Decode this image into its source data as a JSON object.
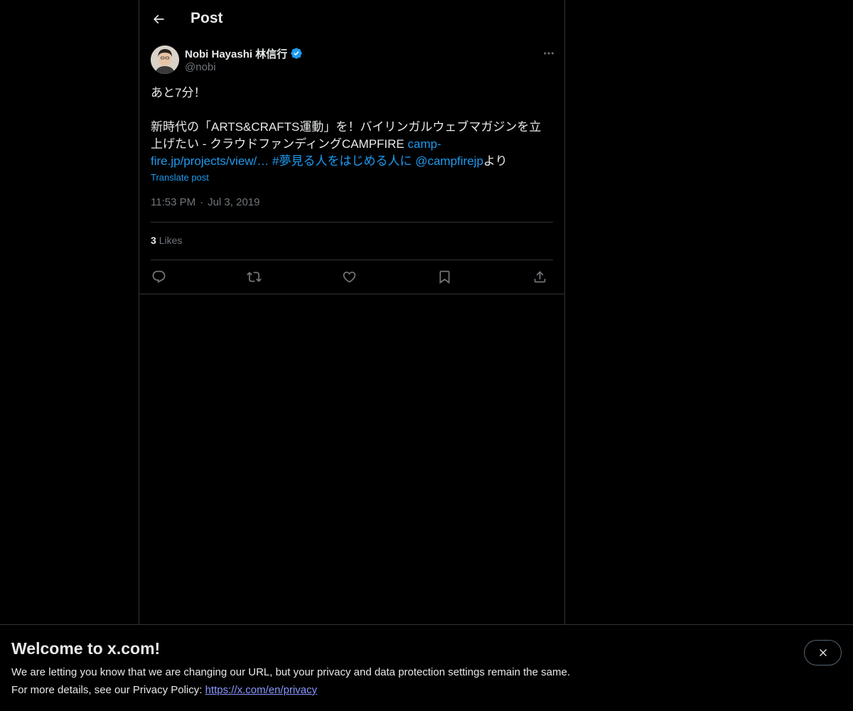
{
  "header": {
    "title": "Post",
    "back_icon": "arrow-left-icon"
  },
  "post": {
    "author": {
      "display_name": "Nobi Hayashi 林信行",
      "handle": "@nobi",
      "verified": true,
      "verified_color": "#1d9bf0"
    },
    "text_line1": "あと7分！",
    "text_body": "新時代の「ARTS&CRAFTS運動」を！バイリンガルウェブマガジンを立上げたい - クラウドファンディングCAMPFIRE ",
    "link_url": "camp-fire.jp/projects/view/…",
    "hashtag": "#夢見る人をはじめる人に",
    "mention": "@campfirejp",
    "text_suffix": "より",
    "translate_label": "Translate post",
    "time": "11:53 PM",
    "separator": "·",
    "date": "Jul 3, 2019",
    "likes_count": "3",
    "likes_label": "Likes",
    "actions": [
      "reply-icon",
      "repost-icon",
      "like-icon",
      "bookmark-icon",
      "share-icon"
    ]
  },
  "banner": {
    "title": "Welcome to x.com!",
    "line1": "We are letting you know that we are changing our URL, but your privacy and data protection settings remain the same.",
    "line2_prefix": "For more details, see our Privacy Policy: ",
    "privacy_link": "https://x.com/en/privacy",
    "close_icon": "close-icon"
  },
  "colors": {
    "background": "#000000",
    "text": "#e7e9ea",
    "secondary_text": "#71767b",
    "link": "#1d9bf0",
    "border": "#2f3336"
  }
}
